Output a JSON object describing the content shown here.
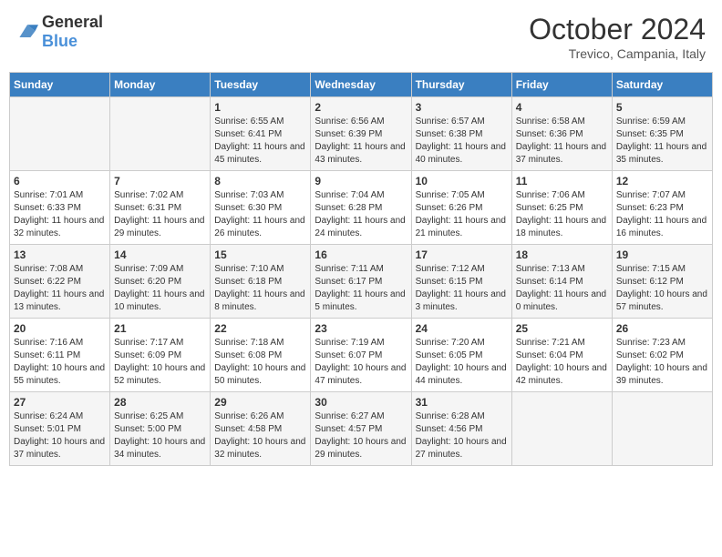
{
  "header": {
    "logo": {
      "general": "General",
      "blue": "Blue"
    },
    "title": "October 2024",
    "subtitle": "Trevico, Campania, Italy"
  },
  "days_of_week": [
    "Sunday",
    "Monday",
    "Tuesday",
    "Wednesday",
    "Thursday",
    "Friday",
    "Saturday"
  ],
  "weeks": [
    [
      {
        "day": "",
        "sunrise": "",
        "sunset": "",
        "daylight": ""
      },
      {
        "day": "",
        "sunrise": "",
        "sunset": "",
        "daylight": ""
      },
      {
        "day": "1",
        "sunrise": "Sunrise: 6:55 AM",
        "sunset": "Sunset: 6:41 PM",
        "daylight": "Daylight: 11 hours and 45 minutes."
      },
      {
        "day": "2",
        "sunrise": "Sunrise: 6:56 AM",
        "sunset": "Sunset: 6:39 PM",
        "daylight": "Daylight: 11 hours and 43 minutes."
      },
      {
        "day": "3",
        "sunrise": "Sunrise: 6:57 AM",
        "sunset": "Sunset: 6:38 PM",
        "daylight": "Daylight: 11 hours and 40 minutes."
      },
      {
        "day": "4",
        "sunrise": "Sunrise: 6:58 AM",
        "sunset": "Sunset: 6:36 PM",
        "daylight": "Daylight: 11 hours and 37 minutes."
      },
      {
        "day": "5",
        "sunrise": "Sunrise: 6:59 AM",
        "sunset": "Sunset: 6:35 PM",
        "daylight": "Daylight: 11 hours and 35 minutes."
      }
    ],
    [
      {
        "day": "6",
        "sunrise": "Sunrise: 7:01 AM",
        "sunset": "Sunset: 6:33 PM",
        "daylight": "Daylight: 11 hours and 32 minutes."
      },
      {
        "day": "7",
        "sunrise": "Sunrise: 7:02 AM",
        "sunset": "Sunset: 6:31 PM",
        "daylight": "Daylight: 11 hours and 29 minutes."
      },
      {
        "day": "8",
        "sunrise": "Sunrise: 7:03 AM",
        "sunset": "Sunset: 6:30 PM",
        "daylight": "Daylight: 11 hours and 26 minutes."
      },
      {
        "day": "9",
        "sunrise": "Sunrise: 7:04 AM",
        "sunset": "Sunset: 6:28 PM",
        "daylight": "Daylight: 11 hours and 24 minutes."
      },
      {
        "day": "10",
        "sunrise": "Sunrise: 7:05 AM",
        "sunset": "Sunset: 6:26 PM",
        "daylight": "Daylight: 11 hours and 21 minutes."
      },
      {
        "day": "11",
        "sunrise": "Sunrise: 7:06 AM",
        "sunset": "Sunset: 6:25 PM",
        "daylight": "Daylight: 11 hours and 18 minutes."
      },
      {
        "day": "12",
        "sunrise": "Sunrise: 7:07 AM",
        "sunset": "Sunset: 6:23 PM",
        "daylight": "Daylight: 11 hours and 16 minutes."
      }
    ],
    [
      {
        "day": "13",
        "sunrise": "Sunrise: 7:08 AM",
        "sunset": "Sunset: 6:22 PM",
        "daylight": "Daylight: 11 hours and 13 minutes."
      },
      {
        "day": "14",
        "sunrise": "Sunrise: 7:09 AM",
        "sunset": "Sunset: 6:20 PM",
        "daylight": "Daylight: 11 hours and 10 minutes."
      },
      {
        "day": "15",
        "sunrise": "Sunrise: 7:10 AM",
        "sunset": "Sunset: 6:18 PM",
        "daylight": "Daylight: 11 hours and 8 minutes."
      },
      {
        "day": "16",
        "sunrise": "Sunrise: 7:11 AM",
        "sunset": "Sunset: 6:17 PM",
        "daylight": "Daylight: 11 hours and 5 minutes."
      },
      {
        "day": "17",
        "sunrise": "Sunrise: 7:12 AM",
        "sunset": "Sunset: 6:15 PM",
        "daylight": "Daylight: 11 hours and 3 minutes."
      },
      {
        "day": "18",
        "sunrise": "Sunrise: 7:13 AM",
        "sunset": "Sunset: 6:14 PM",
        "daylight": "Daylight: 11 hours and 0 minutes."
      },
      {
        "day": "19",
        "sunrise": "Sunrise: 7:15 AM",
        "sunset": "Sunset: 6:12 PM",
        "daylight": "Daylight: 10 hours and 57 minutes."
      }
    ],
    [
      {
        "day": "20",
        "sunrise": "Sunrise: 7:16 AM",
        "sunset": "Sunset: 6:11 PM",
        "daylight": "Daylight: 10 hours and 55 minutes."
      },
      {
        "day": "21",
        "sunrise": "Sunrise: 7:17 AM",
        "sunset": "Sunset: 6:09 PM",
        "daylight": "Daylight: 10 hours and 52 minutes."
      },
      {
        "day": "22",
        "sunrise": "Sunrise: 7:18 AM",
        "sunset": "Sunset: 6:08 PM",
        "daylight": "Daylight: 10 hours and 50 minutes."
      },
      {
        "day": "23",
        "sunrise": "Sunrise: 7:19 AM",
        "sunset": "Sunset: 6:07 PM",
        "daylight": "Daylight: 10 hours and 47 minutes."
      },
      {
        "day": "24",
        "sunrise": "Sunrise: 7:20 AM",
        "sunset": "Sunset: 6:05 PM",
        "daylight": "Daylight: 10 hours and 44 minutes."
      },
      {
        "day": "25",
        "sunrise": "Sunrise: 7:21 AM",
        "sunset": "Sunset: 6:04 PM",
        "daylight": "Daylight: 10 hours and 42 minutes."
      },
      {
        "day": "26",
        "sunrise": "Sunrise: 7:23 AM",
        "sunset": "Sunset: 6:02 PM",
        "daylight": "Daylight: 10 hours and 39 minutes."
      }
    ],
    [
      {
        "day": "27",
        "sunrise": "Sunrise: 6:24 AM",
        "sunset": "Sunset: 5:01 PM",
        "daylight": "Daylight: 10 hours and 37 minutes."
      },
      {
        "day": "28",
        "sunrise": "Sunrise: 6:25 AM",
        "sunset": "Sunset: 5:00 PM",
        "daylight": "Daylight: 10 hours and 34 minutes."
      },
      {
        "day": "29",
        "sunrise": "Sunrise: 6:26 AM",
        "sunset": "Sunset: 4:58 PM",
        "daylight": "Daylight: 10 hours and 32 minutes."
      },
      {
        "day": "30",
        "sunrise": "Sunrise: 6:27 AM",
        "sunset": "Sunset: 4:57 PM",
        "daylight": "Daylight: 10 hours and 29 minutes."
      },
      {
        "day": "31",
        "sunrise": "Sunrise: 6:28 AM",
        "sunset": "Sunset: 4:56 PM",
        "daylight": "Daylight: 10 hours and 27 minutes."
      },
      {
        "day": "",
        "sunrise": "",
        "sunset": "",
        "daylight": ""
      },
      {
        "day": "",
        "sunrise": "",
        "sunset": "",
        "daylight": ""
      }
    ]
  ]
}
